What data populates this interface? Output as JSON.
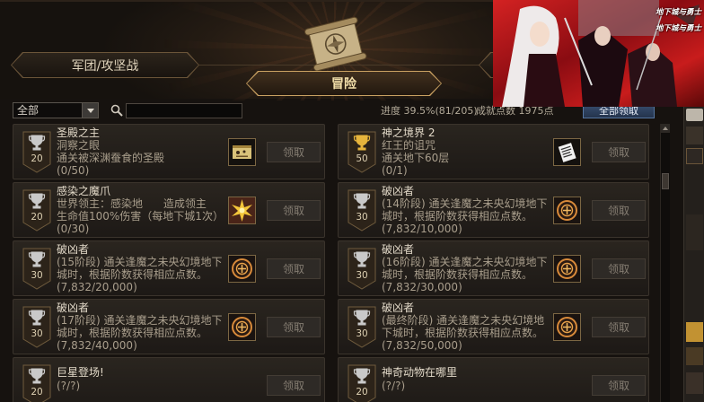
{
  "tabs": {
    "left": "军团/攻坚战",
    "active": "冒险"
  },
  "filter": {
    "category": "全部",
    "search_value": "",
    "progress": "进度 39.5%(81/205)",
    "points": "成就点数 1975点",
    "claim_all": "全部领取"
  },
  "ad": {
    "logo_line1": "地下城与勇士",
    "logo_line2": "地下城与勇士"
  },
  "colors": {
    "accent_gold": "#caa262",
    "silver_trophy": "#c9c9c9",
    "gold_trophy": "#e6b43c",
    "claim_all_blue": "#3b5174"
  },
  "achievements": [
    {
      "points": "20",
      "trophy_color": "#c9c9c9",
      "title": "圣殿之主",
      "lines": [
        "洞察之眼",
        "通关被深渊蚕食的圣殿"
      ],
      "progress": "(0/50)",
      "icon": "scroll-map-icon",
      "claim": "领取"
    },
    {
      "points": "50",
      "trophy_color": "#e6b43c",
      "title": "神之境界 2",
      "lines": [
        "红王的诅咒",
        "通关地下60层"
      ],
      "progress": "(0/1)",
      "icon": "paper-note-icon",
      "claim": "领取"
    },
    {
      "points": "20",
      "trophy_color": "#c9c9c9",
      "title": "感染之魔爪",
      "lines": [
        "世界领主：感染地      造成领主",
        "生命值100%伤害（每地下城1次）"
      ],
      "progress": "(0/30)",
      "icon": "starburst-icon",
      "claim": "领取"
    },
    {
      "points": "30",
      "trophy_color": "#c9c9c9",
      "title": "破凶者",
      "lines": [
        "(14阶段) 通关逢魔之未央幻境地下",
        "城时，根据阶数获得相应点数。"
      ],
      "progress": "(7,832/10,000)",
      "icon": "emblem-icon",
      "claim": "领取"
    },
    {
      "points": "30",
      "trophy_color": "#c9c9c9",
      "title": "破凶者",
      "lines": [
        "(15阶段) 通关逢魔之未央幻境地下",
        "城时，根据阶数获得相应点数。"
      ],
      "progress": "(7,832/20,000)",
      "icon": "emblem-icon",
      "claim": "领取"
    },
    {
      "points": "30",
      "trophy_color": "#c9c9c9",
      "title": "破凶者",
      "lines": [
        "(16阶段) 通关逢魔之未央幻境地下",
        "城时，根据阶数获得相应点数。"
      ],
      "progress": "(7,832/30,000)",
      "icon": "emblem-icon",
      "claim": "领取"
    },
    {
      "points": "30",
      "trophy_color": "#c9c9c9",
      "title": "破凶者",
      "lines": [
        "(17阶段) 通关逢魔之未央幻境地下",
        "城时，根据阶数获得相应点数。"
      ],
      "progress": "(7,832/40,000)",
      "icon": "emblem-icon",
      "claim": "领取"
    },
    {
      "points": "30",
      "trophy_color": "#c9c9c9",
      "title": "破凶者",
      "lines": [
        "(最终阶段) 通关逢魔之未央幻境地",
        "下城时，根据阶数获得相应点数。"
      ],
      "progress": "(7,832/50,000)",
      "icon": "emblem-icon",
      "claim": "领取"
    },
    {
      "points": "20",
      "trophy_color": "#c9c9c9",
      "title": "巨星登场!",
      "lines": [],
      "progress": "(?/?)",
      "claim": "领取"
    },
    {
      "points": "20",
      "trophy_color": "#c9c9c9",
      "title": "神奇动物在哪里",
      "lines": [],
      "progress": "(?/?)",
      "claim": "领取"
    }
  ]
}
